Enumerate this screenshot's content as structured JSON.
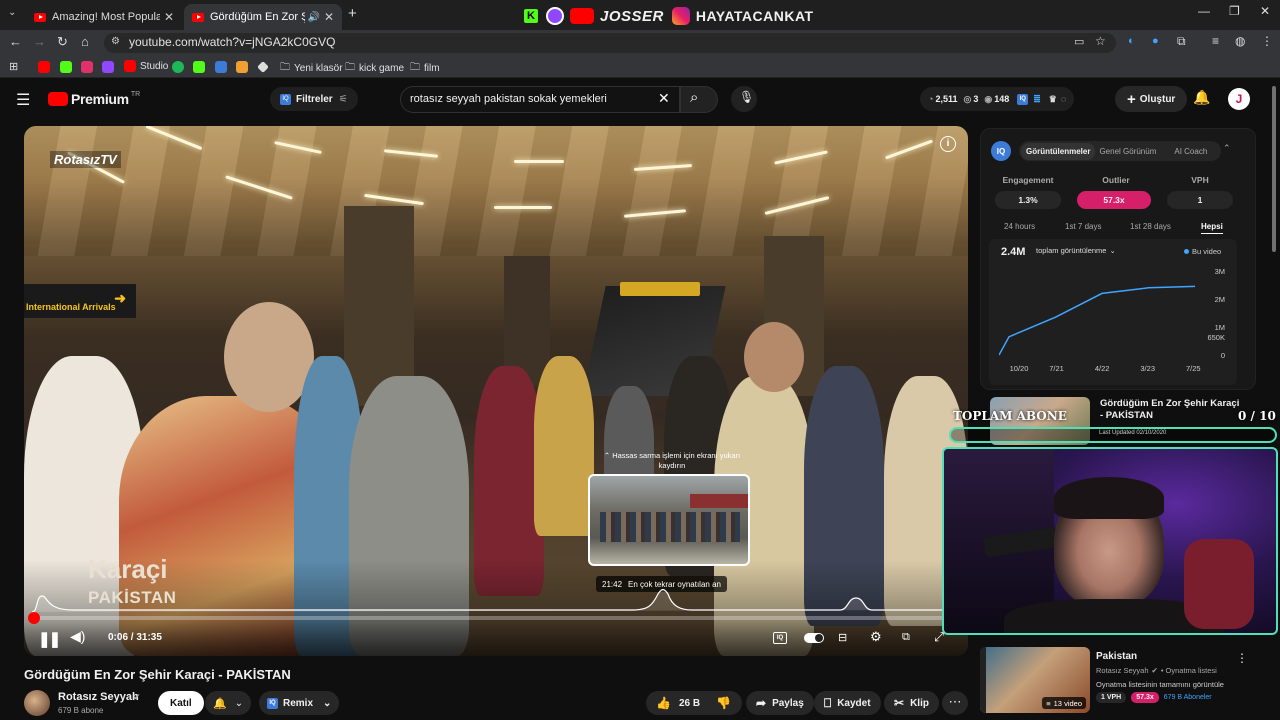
{
  "browser": {
    "tabs": [
      {
        "title": "Amazing! Most Popular Indian S",
        "active": false
      },
      {
        "title": "Gördüğüm En Zor Şehir Karaç",
        "active": true
      }
    ],
    "url": "youtube.com/watch?v=jNGA2kC0GVQ",
    "bookmarks": [
      "Studio",
      "Yeni klasör",
      "kick game",
      "film"
    ]
  },
  "stream_banner": {
    "text1": "JOSSER",
    "text2": "HAYATACANKAT"
  },
  "youtube": {
    "logo": "Premium",
    "logo_sup": "TR",
    "filters_label": "Filtreler",
    "search_query": "rotasız seyyah pakistan sokak yemekleri",
    "stats": {
      "views": "2,511",
      "count2": "3",
      "count3": "148"
    },
    "create_label": "Oluştur",
    "avatar_letter": "J"
  },
  "video": {
    "channel_watermark": "RotasızTV",
    "location_title": "Karaçi",
    "location_sub": "PAKİSTAN",
    "hint_text": "⌃ Hassas sarma işlemi için ekranı yukarı kaydırın",
    "preview_time": "21:42",
    "preview_label": "En çok tekrar oynatılan an",
    "current_time": "0:06 / 31:35",
    "progress": 0.003
  },
  "meta": {
    "title": "Gördüğüm En Zor Şehir Karaçi - PAKİSTAN",
    "channel": "Rotasız Seyyah",
    "subscribers": "679 B abone",
    "join_label": "Katıl",
    "remix_label": "Remix",
    "likes": "26 B",
    "share_label": "Paylaş",
    "save_label": "Kaydet",
    "clip_label": "Klip"
  },
  "vidiq": {
    "tabs": [
      "Görüntülenmeler",
      "Genel Görünüm",
      "AI Coach"
    ],
    "metrics": [
      {
        "label": "Engagement",
        "value": "1.3%"
      },
      {
        "label": "Outlier",
        "value": "57.3x"
      },
      {
        "label": "VPH",
        "value": "1"
      }
    ],
    "ranges": [
      "24 hours",
      "1st 7 days",
      "1st 28 days",
      "Hepsi"
    ],
    "total": "2.4M",
    "dropdown": "toplam görüntülenme",
    "legend": "Bu video"
  },
  "chart_data": {
    "type": "line",
    "x": [
      "10/20",
      "7/21",
      "4/22",
      "3/23",
      "7/25"
    ],
    "ylabels": [
      "0",
      "650K",
      "1M",
      "2M",
      "3M"
    ],
    "series": [
      {
        "name": "Bu video",
        "values": [
          0.65,
          1.35,
          2.2,
          2.4,
          2.45
        ]
      }
    ],
    "ylim": [
      0,
      3
    ]
  },
  "overlay": {
    "sub_goal_label": "TOPLAM ABONE",
    "sub_goal_value": "0 / 10"
  },
  "recommended": [
    {
      "title": "Gördüğüm En Zor Şehir Karaçi - PAKİSTAN",
      "sub": "Last Updated 02/10/2020"
    },
    {
      "title": "Pakistan",
      "channel": "Rotasız Seyyah",
      "meta": "• Oynatma listesi",
      "link": "Oynatma listesinin tamamını görüntüle",
      "badge1": "1 VPH",
      "badge2": "57.3x",
      "subs": "679 B Aboneler",
      "count": "13 video"
    }
  ],
  "colors": {
    "accent": "#ff0000",
    "outlier": "#d61f69",
    "vidiq": "#3ea6ff",
    "overlay": "#4fe0b8"
  }
}
